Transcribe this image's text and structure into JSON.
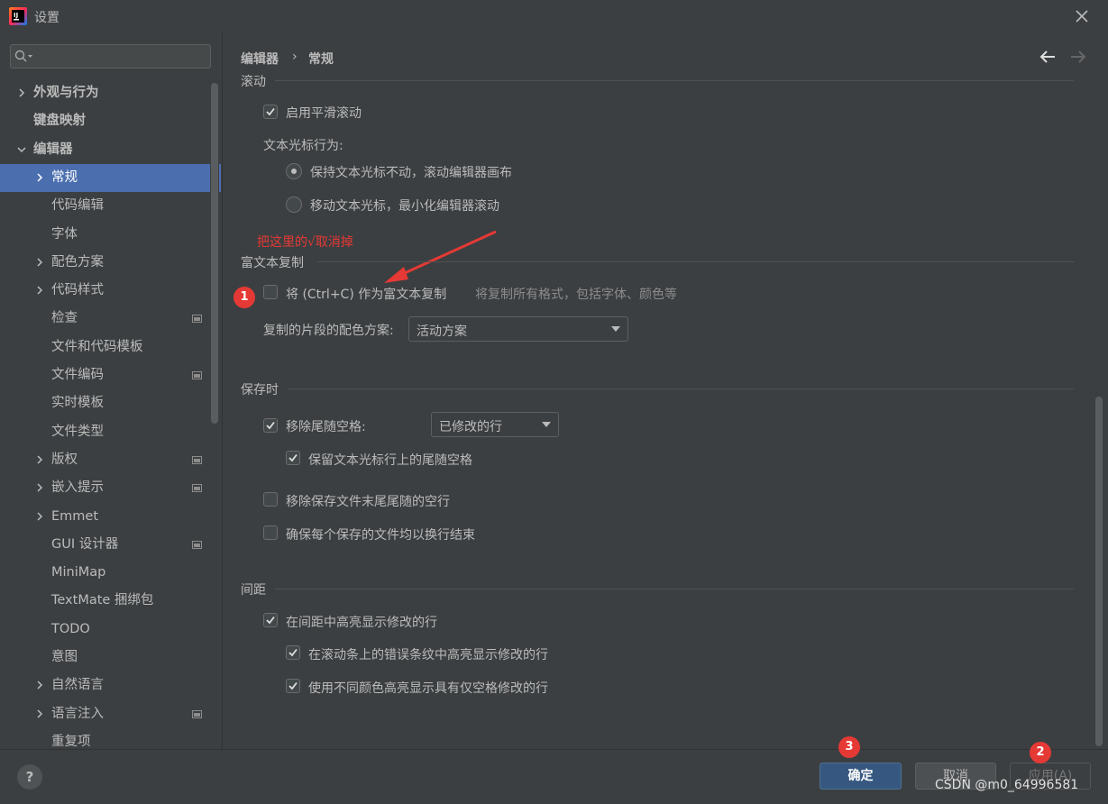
{
  "window": {
    "title": "设置"
  },
  "sidebar": {
    "search_placeholder": "",
    "items": [
      {
        "label": "外观与行为",
        "chevron": "right",
        "bold": true
      },
      {
        "label": "键盘映射",
        "chevron": "none",
        "bold": true
      },
      {
        "label": "编辑器",
        "chevron": "down",
        "bold": true
      },
      {
        "label": "常规",
        "chevron": "right",
        "selected": true
      },
      {
        "label": "代码编辑",
        "chevron": "none"
      },
      {
        "label": "字体",
        "chevron": "none"
      },
      {
        "label": "配色方案",
        "chevron": "right"
      },
      {
        "label": "代码样式",
        "chevron": "right"
      },
      {
        "label": "检查",
        "chevron": "none",
        "badge": true
      },
      {
        "label": "文件和代码模板",
        "chevron": "none"
      },
      {
        "label": "文件编码",
        "chevron": "none",
        "badge": true
      },
      {
        "label": "实时模板",
        "chevron": "none"
      },
      {
        "label": "文件类型",
        "chevron": "none"
      },
      {
        "label": "版权",
        "chevron": "right",
        "badge": true
      },
      {
        "label": "嵌入提示",
        "chevron": "right",
        "badge": true
      },
      {
        "label": "Emmet",
        "chevron": "right"
      },
      {
        "label": "GUI 设计器",
        "chevron": "none",
        "badge": true
      },
      {
        "label": "MiniMap",
        "chevron": "none"
      },
      {
        "label": "TextMate 捆绑包",
        "chevron": "none"
      },
      {
        "label": "TODO",
        "chevron": "none"
      },
      {
        "label": "意图",
        "chevron": "none"
      },
      {
        "label": "自然语言",
        "chevron": "right"
      },
      {
        "label": "语言注入",
        "chevron": "right",
        "badge": true
      },
      {
        "label": "重复项",
        "chevron": "none"
      }
    ]
  },
  "breadcrumb": {
    "parent": "编辑器",
    "separator": "›",
    "current": "常规"
  },
  "scrolling": {
    "section_title": "滚动",
    "smooth_scroll": {
      "label": "启用平滑滚动",
      "checked": true
    },
    "caret_behavior_label": "文本光标行为:",
    "radio_keep": {
      "label": "保持文本光标不动，滚动编辑器画布",
      "selected": true
    },
    "radio_move": {
      "label": "移动文本光标，最小化编辑器滚动",
      "selected": false
    }
  },
  "annotation": {
    "note": "把这里的√取消掉",
    "badge_1": "1",
    "badge_2": "2",
    "badge_3": "3"
  },
  "rich_copy": {
    "section_title": "富文本复制",
    "copy_as_rich": {
      "label": "将 (Ctrl+C) 作为富文本复制",
      "checked": false
    },
    "hint": "将复制所有格式，包括字体、颜色等",
    "scheme_label": "复制的片段的配色方案:",
    "scheme_value": "活动方案"
  },
  "on_save": {
    "section_title": "保存时",
    "strip_trailing": {
      "label": "移除尾随空格:",
      "checked": true,
      "combo_value": "已修改的行"
    },
    "keep_caret_ws": {
      "label": "保留文本光标行上的尾随空格",
      "checked": true
    },
    "remove_blank_end": {
      "label": "移除保存文件末尾尾随的空行",
      "checked": false
    },
    "ensure_newline": {
      "label": "确保每个保存的文件均以换行结束",
      "checked": false
    }
  },
  "gutter": {
    "section_title": "间距",
    "highlight_modified": {
      "label": "在间距中高亮显示修改的行",
      "checked": true
    },
    "error_stripe": {
      "label": "在滚动条上的错误条纹中高亮显示修改的行",
      "checked": true
    },
    "whitespace_color": {
      "label": "使用不同颜色高亮显示具有仅空格修改的行",
      "checked": true
    }
  },
  "buttons": {
    "help": "?",
    "ok": "确定",
    "cancel": "取消",
    "apply": "应用(A)"
  },
  "watermark": "CSDN @m0_64996581",
  "colors": {
    "bg": "#3c3f41",
    "selected": "#4b6eaf",
    "primary_button": "#365880",
    "annotation": "#e53935"
  }
}
